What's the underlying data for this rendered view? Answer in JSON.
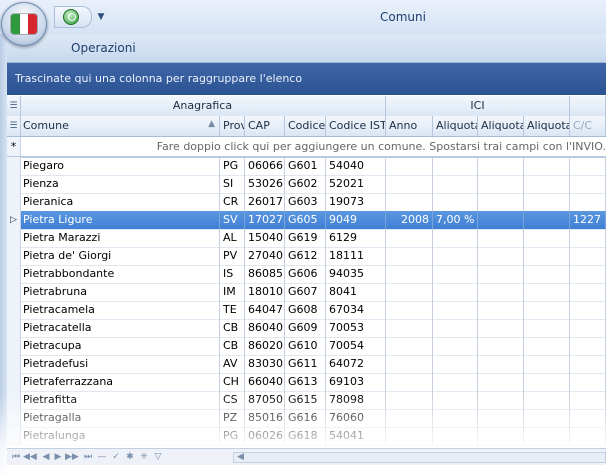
{
  "window": {
    "title": "Comuni"
  },
  "ribbon": {
    "tab_label": "Operazioni"
  },
  "flag_colors": [
    "#2e9a3d",
    "#ffffff",
    "#d7262e"
  ],
  "groupby": {
    "hint": "Trascinate qui una colonna per raggruppare l'elenco"
  },
  "bands": {
    "anagrafica": "Anagrafica",
    "ici": "ICI"
  },
  "columns": {
    "comune": "Comune",
    "prov": "Prov",
    "cap": "CAP",
    "codice": "Codice",
    "codice_istat": "Codice ISTAT",
    "anno": "Anno",
    "aliquota1": "Aliquota",
    "aliquota2": "Aliquota",
    "aliquota3": "Aliquota",
    "cc": "C/C"
  },
  "new_row": {
    "hint": "Fare doppio click qui per aggiungere un comune. Spostarsi trai campi con l'INVIO."
  },
  "rows": [
    {
      "comune": "Piegaro",
      "prov": "PG",
      "cap": "06066",
      "codice": "G601",
      "istat": "54040"
    },
    {
      "comune": "Pienza",
      "prov": "SI",
      "cap": "53026",
      "codice": "G602",
      "istat": "52021"
    },
    {
      "comune": "Pieranica",
      "prov": "CR",
      "cap": "26017",
      "codice": "G603",
      "istat": "19073"
    },
    {
      "comune": "Pietra Ligure",
      "prov": "SV",
      "cap": "17027",
      "codice": "G605",
      "istat": "9049",
      "anno": "2008",
      "aliquota1": "7,00 %",
      "cc": "1227"
    },
    {
      "comune": "Pietra Marazzi",
      "prov": "AL",
      "cap": "15040",
      "codice": "G619",
      "istat": "6129"
    },
    {
      "comune": "Pietra de' Giorgi",
      "prov": "PV",
      "cap": "27040",
      "codice": "G612",
      "istat": "18111"
    },
    {
      "comune": "Pietrabbondante",
      "prov": "IS",
      "cap": "86085",
      "codice": "G606",
      "istat": "94035"
    },
    {
      "comune": "Pietrabruna",
      "prov": "IM",
      "cap": "18010",
      "codice": "G607",
      "istat": "8041"
    },
    {
      "comune": "Pietracamela",
      "prov": "TE",
      "cap": "64047",
      "codice": "G608",
      "istat": "67034"
    },
    {
      "comune": "Pietracatella",
      "prov": "CB",
      "cap": "86040",
      "codice": "G609",
      "istat": "70053"
    },
    {
      "comune": "Pietracupa",
      "prov": "CB",
      "cap": "86020",
      "codice": "G610",
      "istat": "70054"
    },
    {
      "comune": "Pietradefusi",
      "prov": "AV",
      "cap": "83030",
      "codice": "G611",
      "istat": "64072"
    },
    {
      "comune": "Pietraferrazzana",
      "prov": "CH",
      "cap": "66040",
      "codice": "G613",
      "istat": "69103"
    },
    {
      "comune": "Pietrafitta",
      "prov": "CS",
      "cap": "87050",
      "codice": "G615",
      "istat": "78098"
    },
    {
      "comune": "Pietragalla",
      "prov": "PZ",
      "cap": "85016",
      "codice": "G616",
      "istat": "76060"
    },
    {
      "comune": "Pietralunga",
      "prov": "PG",
      "cap": "06026",
      "codice": "G618",
      "istat": "54041"
    }
  ],
  "selected_row_index": 3
}
